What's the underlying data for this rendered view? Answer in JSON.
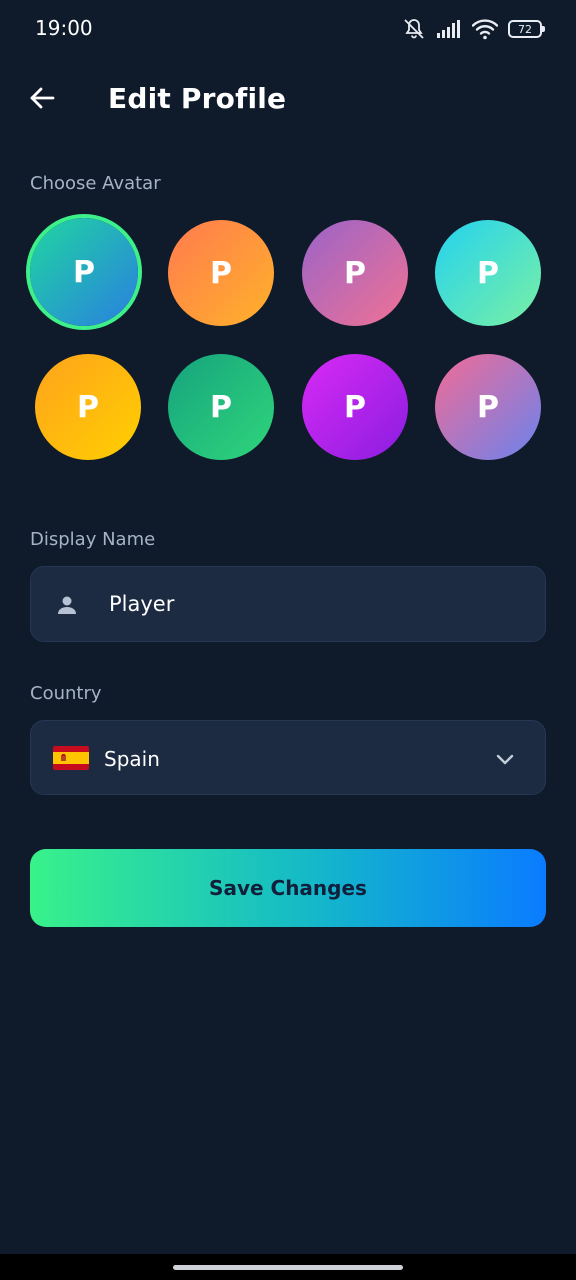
{
  "status_bar": {
    "time": "19:00",
    "battery": "72",
    "icons": [
      "mute-icon",
      "signal-icon",
      "wifi-icon",
      "battery-icon"
    ]
  },
  "header": {
    "title": "Edit Profile",
    "back_icon": "arrow-left-icon"
  },
  "avatars": {
    "label": "Choose Avatar",
    "selected_index": 0,
    "items": [
      {
        "letter": "P",
        "colors": [
          "#1fd6a0",
          "#2a7fe0"
        ]
      },
      {
        "letter": "P",
        "colors": [
          "#ff7a4f",
          "#ffb22a"
        ]
      },
      {
        "letter": "P",
        "colors": [
          "#9a63c9",
          "#f07294"
        ]
      },
      {
        "letter": "P",
        "colors": [
          "#23d2f0",
          "#7af0a4"
        ]
      },
      {
        "letter": "P",
        "colors": [
          "#ffa31c",
          "#ffcf00"
        ]
      },
      {
        "letter": "P",
        "colors": [
          "#16a37e",
          "#2fd67a"
        ]
      },
      {
        "letter": "P",
        "colors": [
          "#d92af5",
          "#8a1de0"
        ]
      },
      {
        "letter": "P",
        "colors": [
          "#f26b95",
          "#6a83ee"
        ]
      }
    ]
  },
  "display_name": {
    "label": "Display Name",
    "value": "Player",
    "icon": "person-icon"
  },
  "country": {
    "label": "Country",
    "value": "Spain",
    "flag_icon": "spain-flag-icon",
    "dropdown_icon": "chevron-down-icon"
  },
  "save_button": {
    "label": "Save Changes",
    "gradient": [
      "#38f28a",
      "#0a7cff"
    ]
  },
  "colors": {
    "background": "#0f1a2b",
    "field": "#1c2b42",
    "label": "#a5b3c6",
    "selected_ring": "#3ef08a"
  }
}
